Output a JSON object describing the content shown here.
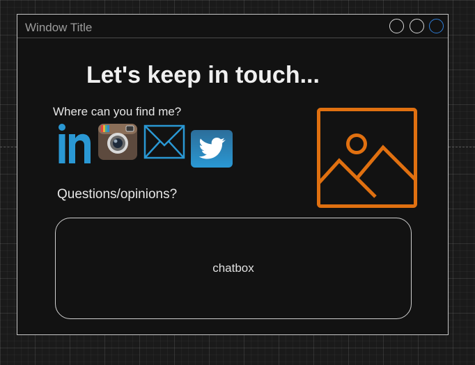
{
  "window": {
    "title": "Window Title"
  },
  "controls": [
    "window-button",
    "window-button",
    "window-button-active"
  ],
  "colors": {
    "accent_blue": "#2f7ed8",
    "image_placeholder": "#e07010",
    "background": "#121212"
  },
  "content": {
    "heading": "Let's keep in touch...",
    "find_label": "Where can you find me?",
    "social_links": [
      {
        "icon": "linkedin-icon"
      },
      {
        "icon": "instagram-icon"
      },
      {
        "icon": "mail-icon"
      },
      {
        "icon": "twitter-icon"
      }
    ],
    "questions_label": "Questions/opinions?",
    "chatbox_label": "chatbox",
    "image_icon": "image-placeholder-icon"
  }
}
